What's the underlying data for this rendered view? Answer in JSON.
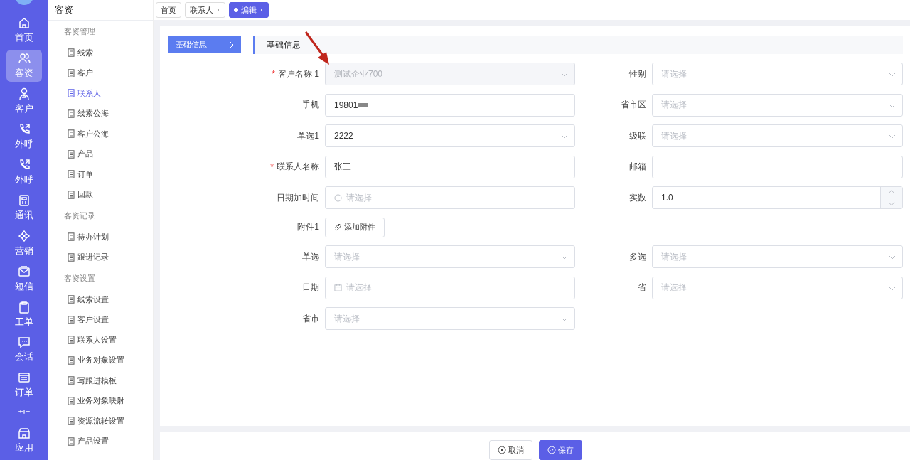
{
  "rail": {
    "items": [
      {
        "label": "首页",
        "selected": false
      },
      {
        "label": "客资",
        "selected": true
      },
      {
        "label": "客户",
        "selected": false
      },
      {
        "label": "外呼",
        "selected": false
      },
      {
        "label": "外呼",
        "selected": false
      },
      {
        "label": "通讯",
        "selected": false
      },
      {
        "label": "营销",
        "selected": false
      },
      {
        "label": "短信",
        "selected": false
      },
      {
        "label": "工单",
        "selected": false
      },
      {
        "label": "会话",
        "selected": false
      },
      {
        "label": "订单",
        "selected": false
      },
      {
        "label": "应用",
        "selected": false
      }
    ]
  },
  "sidebar": {
    "title": "客资",
    "groups": [
      {
        "title": "客资管理",
        "items": [
          {
            "label": "线索",
            "selected": false
          },
          {
            "label": "客户",
            "selected": false
          },
          {
            "label": "联系人",
            "selected": true
          },
          {
            "label": "线索公海",
            "selected": false
          },
          {
            "label": "客户公海",
            "selected": false
          },
          {
            "label": "产品",
            "selected": false
          },
          {
            "label": "订单",
            "selected": false
          },
          {
            "label": "回款",
            "selected": false
          }
        ]
      },
      {
        "title": "客资记录",
        "items": [
          {
            "label": "待办计划",
            "selected": false
          },
          {
            "label": "跟进记录",
            "selected": false
          }
        ]
      },
      {
        "title": "客资设置",
        "items": [
          {
            "label": "线索设置",
            "selected": false
          },
          {
            "label": "客户设置",
            "selected": false
          },
          {
            "label": "联系人设置",
            "selected": false
          },
          {
            "label": "业务对象设置",
            "selected": false
          },
          {
            "label": "写跟进模板",
            "selected": false
          },
          {
            "label": "业务对象映射",
            "selected": false
          },
          {
            "label": "资源流转设置",
            "selected": false
          },
          {
            "label": "产品设置",
            "selected": false
          }
        ]
      }
    ]
  },
  "tabs": [
    {
      "label": "首页",
      "selected": false,
      "closable": false
    },
    {
      "label": "联系人",
      "selected": false,
      "closable": true
    },
    {
      "label": "编辑",
      "selected": true,
      "closable": true
    }
  ],
  "section_nav": [
    {
      "label": "基础信息",
      "selected": true
    }
  ],
  "section_title": "基础信息",
  "form": {
    "rows": [
      {
        "left": {
          "label": "客户名称 1",
          "required_mark": "*",
          "kind": "select",
          "value": "测试企业700",
          "disabled": true
        },
        "right": {
          "label": "性别",
          "kind": "select",
          "placeholder": "请选择"
        }
      },
      {
        "left": {
          "label": "手机",
          "kind": "input",
          "value": "19801",
          "redacted": true
        },
        "right": {
          "label": "省市区",
          "kind": "select",
          "placeholder": "请选择"
        }
      },
      {
        "left": {
          "label": "单选1",
          "kind": "select",
          "value": "2222"
        },
        "right": {
          "label": "级联",
          "kind": "select",
          "placeholder": "请选择"
        }
      },
      {
        "left": {
          "label": "联系人名称",
          "required_mark": "*",
          "kind": "input",
          "value": "张三"
        },
        "right": {
          "label": "邮箱",
          "kind": "input"
        }
      },
      {
        "left": {
          "label": "日期加时间",
          "kind": "datetime",
          "placeholder": "请选择"
        },
        "right": {
          "label": "实数",
          "kind": "number",
          "value": "1.0"
        }
      },
      {
        "left": {
          "label": "附件1",
          "kind": "upload",
          "button": "添加附件"
        }
      },
      {
        "left": {
          "label": "单选",
          "kind": "select",
          "placeholder": "请选择"
        },
        "right": {
          "label": "多选",
          "kind": "select",
          "placeholder": "请选择"
        }
      },
      {
        "left": {
          "label": "日期",
          "kind": "date",
          "placeholder": "请选择"
        },
        "right": {
          "label": "省",
          "kind": "select",
          "placeholder": "请选择"
        }
      },
      {
        "left": {
          "label": "省市",
          "kind": "select",
          "placeholder": "请选择"
        }
      }
    ]
  },
  "footer": {
    "buttons": [
      {
        "label": "取消",
        "kind": "secondary"
      },
      {
        "label": "保存",
        "kind": "primary"
      }
    ]
  }
}
